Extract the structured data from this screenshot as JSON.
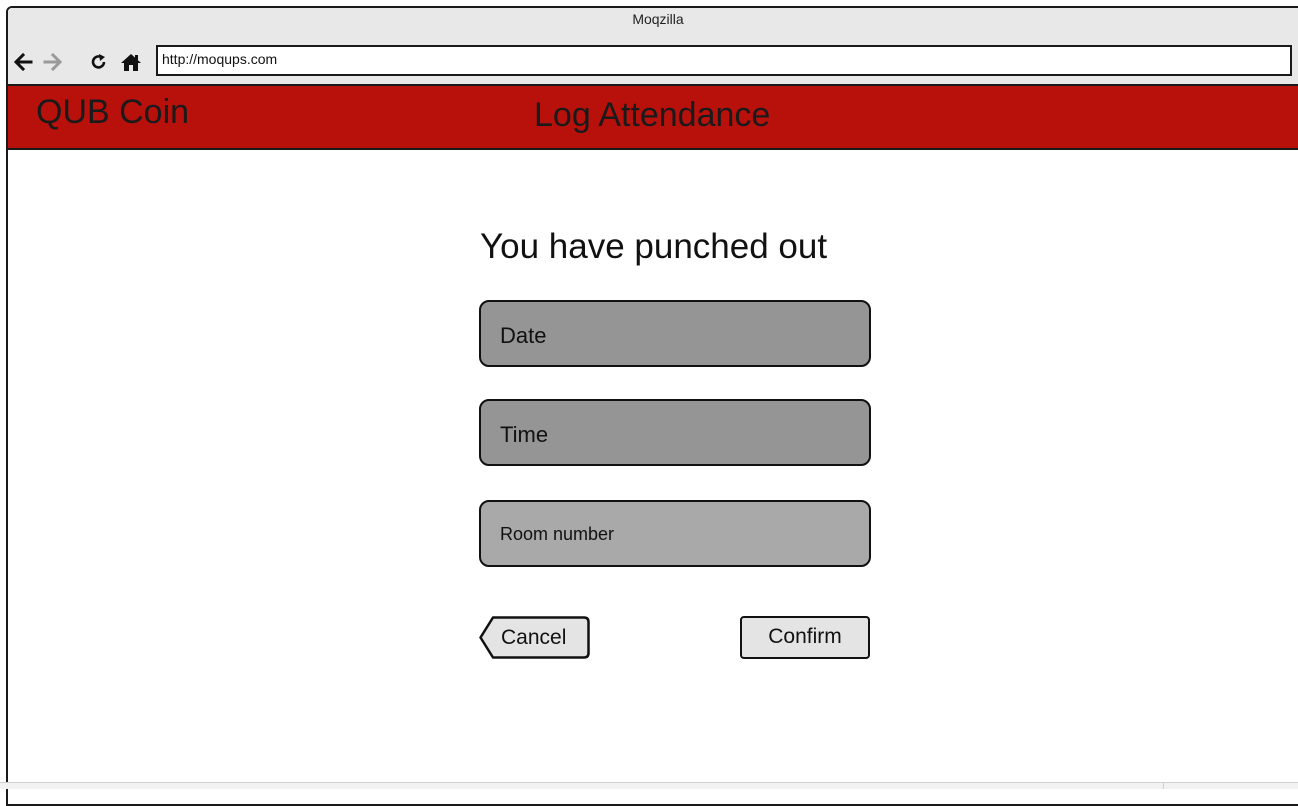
{
  "browser": {
    "window_title": "Moqzilla",
    "url": "http://moqups.com",
    "icons": [
      "back-arrow-icon",
      "forward-arrow-icon",
      "reload-icon",
      "home-icon"
    ]
  },
  "header": {
    "brand": "QUB Coin",
    "title": "Log Attendance",
    "background_color": "#b8110c"
  },
  "main": {
    "heading": "You have punched out",
    "fields": {
      "date": "Date",
      "time": "Time",
      "room": "Room number"
    },
    "buttons": {
      "cancel": "Cancel",
      "confirm": "Confirm"
    }
  }
}
